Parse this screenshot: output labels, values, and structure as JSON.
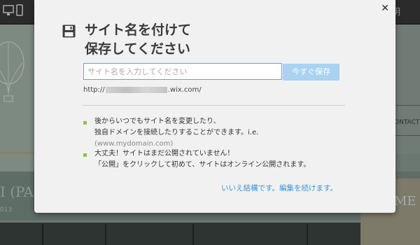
{
  "background": {
    "toolbar_right_text": "明",
    "heading_left": "I (PAR",
    "subtext_left": "013",
    "contact_label": "ONTACT",
    "heading_right": "ME"
  },
  "dialog": {
    "title_line1": "サイト名を付けて",
    "title_line2": "保存してください",
    "input_placeholder": "サイト名を入力してください",
    "input_value": "",
    "save_button_label": "今すぐ保存",
    "url_prefix": "http://",
    "url_suffix": ".wix.com/",
    "notes": [
      {
        "line1": "後からいつでもサイト名を変更したり、",
        "line2": "独自ドメインを接続したりすることができます。i.e.",
        "line2_extra": "(www.mydomain.com)"
      },
      {
        "line1": "大丈夫！サイトはまだ公開されていません！",
        "line2": "「公開」をクリックして初めて、サイトはオンライン公開されます。"
      }
    ],
    "continue_link": "いいえ結構です。編集を続けます。"
  },
  "colors": {
    "accent_blue": "#3a95d6",
    "button_blue_disabled": "#a9d3f1",
    "bullet_green": "#8cc63e",
    "input_border": "#4fa9e6"
  },
  "icons": {
    "dialog_icon": "floppy-disk-icon",
    "close": "close-icon"
  }
}
